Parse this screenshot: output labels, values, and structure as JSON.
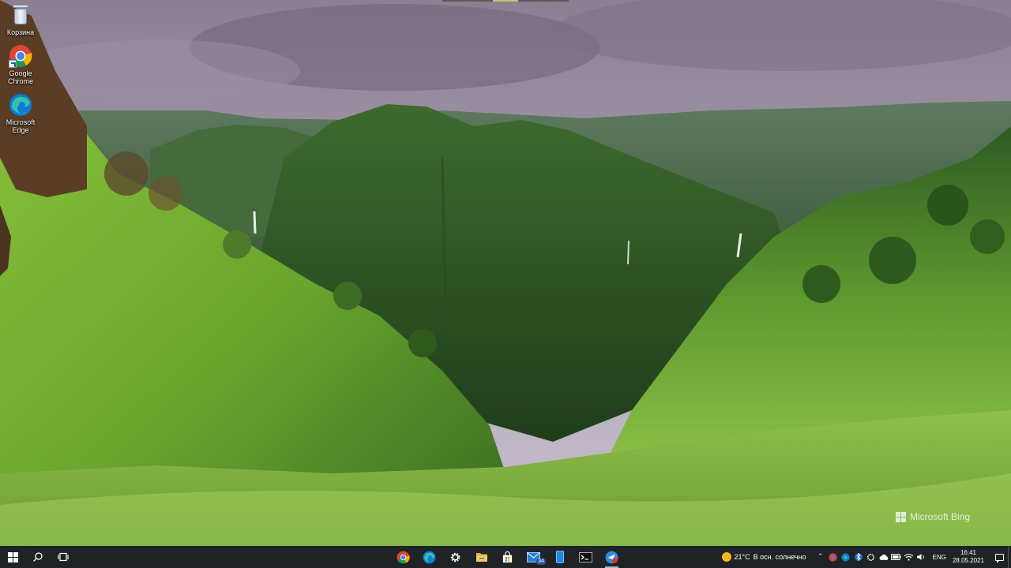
{
  "desktop": {
    "wallpaper_watermark": "Microsoft Bing",
    "icons": [
      {
        "label": "Корзина",
        "icon": "recycle-bin-icon"
      },
      {
        "label": "Google Chrome",
        "icon": "chrome-icon"
      },
      {
        "label": "Microsoft Edge",
        "icon": "edge-icon"
      }
    ]
  },
  "taskbar": {
    "background": "#1f2325",
    "left_buttons": [
      "windows-start-icon",
      "search-icon",
      "task-view-icon"
    ],
    "pinned_apps": [
      {
        "icon": "chrome-icon",
        "running": false
      },
      {
        "icon": "edge-icon",
        "running": false
      },
      {
        "icon": "settings-gear-icon",
        "running": false
      },
      {
        "icon": "file-explorer-icon",
        "running": false
      },
      {
        "icon": "store-icon",
        "running": false
      },
      {
        "icon": "mail-icon",
        "badge": "34",
        "running": false
      },
      {
        "icon": "phone-link-icon",
        "running": false
      },
      {
        "icon": "terminal-icon",
        "running": false
      },
      {
        "icon": "app-icon",
        "running": true
      }
    ],
    "tray": {
      "weather_temp": "21°C",
      "weather_text": "В осн. солнечно",
      "language": "ENG",
      "time": "16:41",
      "date": "28.05.2021"
    }
  }
}
